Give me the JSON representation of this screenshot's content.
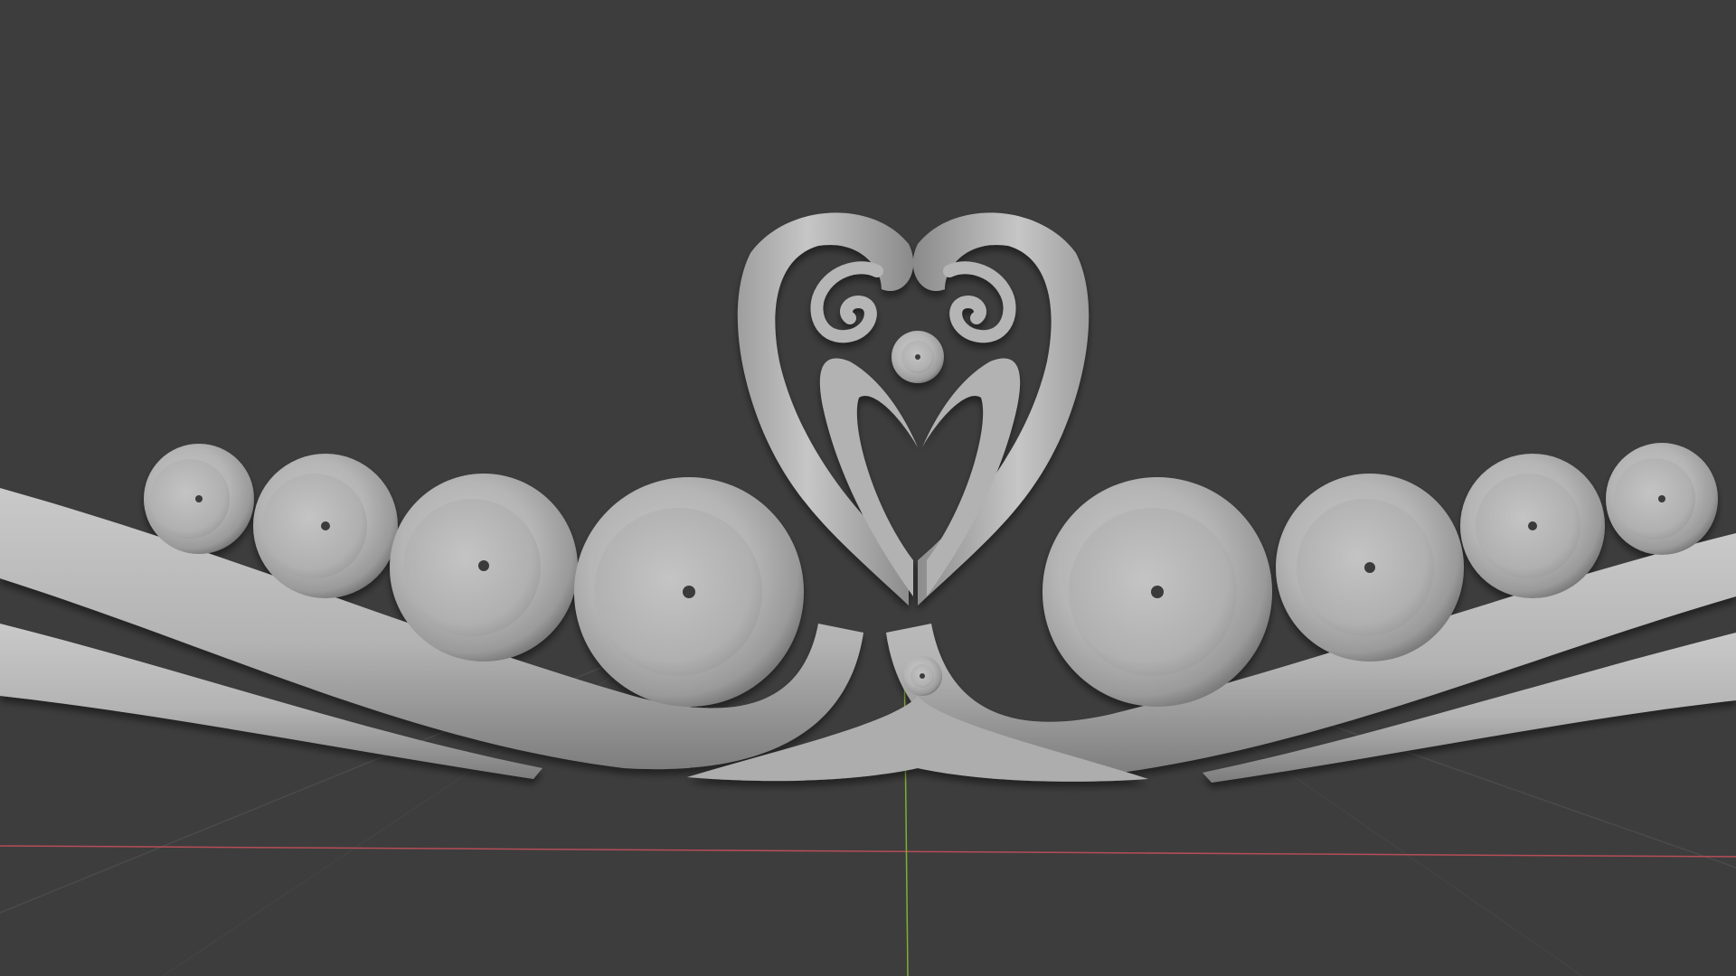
{
  "viewport": {
    "background_color": "#3d3d3d",
    "grid_line_color": "#4a4a4a",
    "x_axis_color": "#b54d57",
    "y_axis_color": "#7fae36",
    "model_color": "#b7b7b7"
  },
  "icons": {
    "model": "ornamental-swan-relief",
    "axes": "3d-viewport-axes"
  }
}
